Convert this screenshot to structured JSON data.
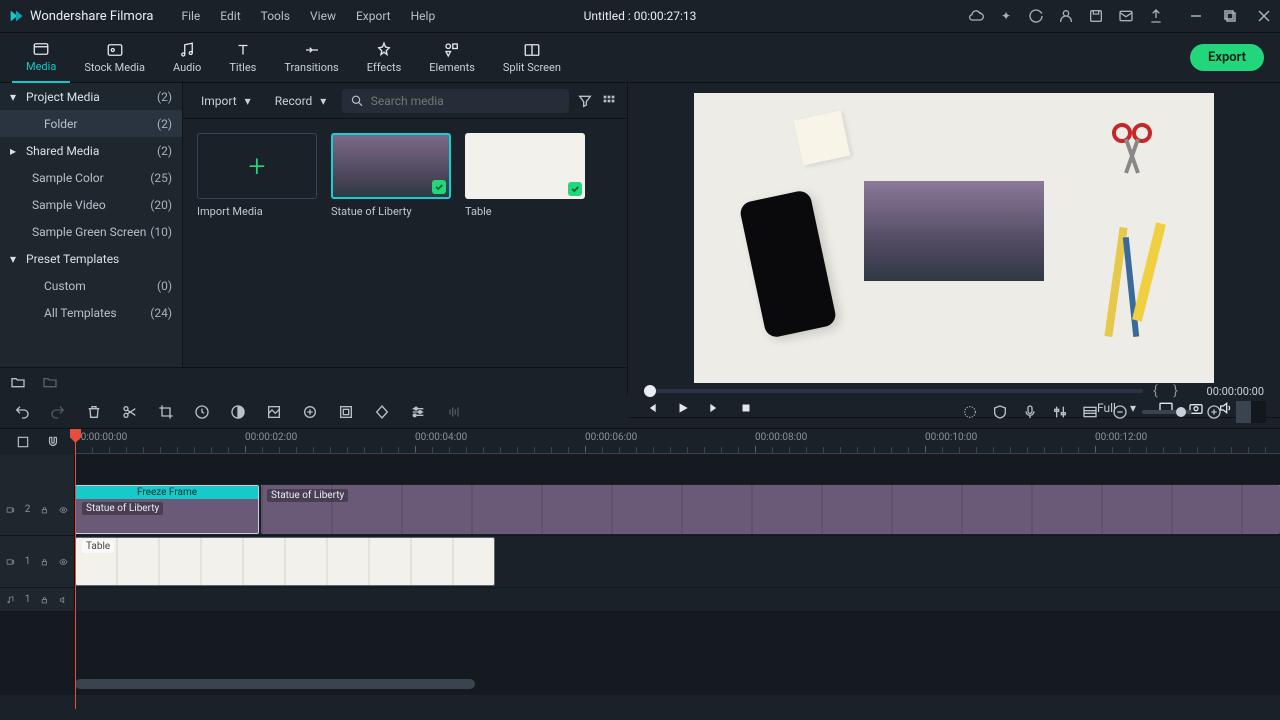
{
  "app": {
    "name": "Wondershare Filmora",
    "title": "Untitled : 00:00:27:13"
  },
  "menu": [
    "File",
    "Edit",
    "Tools",
    "View",
    "Export",
    "Help"
  ],
  "tabs": [
    {
      "label": "Media",
      "active": true
    },
    {
      "label": "Stock Media"
    },
    {
      "label": "Audio"
    },
    {
      "label": "Titles"
    },
    {
      "label": "Transitions"
    },
    {
      "label": "Effects"
    },
    {
      "label": "Elements"
    },
    {
      "label": "Split Screen"
    }
  ],
  "export_btn": "Export",
  "sidebar": {
    "project_media": {
      "label": "Project Media",
      "count": "(2)"
    },
    "folder": {
      "label": "Folder",
      "count": "(2)"
    },
    "shared_media": {
      "label": "Shared Media",
      "count": "(2)"
    },
    "sample_color": {
      "label": "Sample Color",
      "count": "(25)"
    },
    "sample_video": {
      "label": "Sample Video",
      "count": "(20)"
    },
    "sample_green": {
      "label": "Sample Green Screen",
      "count": "(10)"
    },
    "preset_templates": {
      "label": "Preset Templates"
    },
    "custom": {
      "label": "Custom",
      "count": "(0)"
    },
    "all_templates": {
      "label": "All Templates",
      "count": "(24)"
    }
  },
  "media_head": {
    "import": "Import",
    "record": "Record",
    "search_placeholder": "Search media"
  },
  "media_cards": {
    "import": "Import Media",
    "sol": "Statue of Liberty",
    "table": "Table"
  },
  "preview": {
    "timecode": "00:00:00:00",
    "quality": "Full"
  },
  "ruler": [
    "00:00:00:00",
    "00:00:02:00",
    "00:00:04:00",
    "00:00:06:00",
    "00:00:08:00",
    "00:00:10:00",
    "00:00:12:00"
  ],
  "timeline": {
    "freeze_label": "Freeze Frame",
    "clip_sol": "Statue of Liberty",
    "clip_sol2": "Statue of Liberty",
    "clip_table": "Table",
    "tracks": {
      "v2": "2",
      "v1": "1",
      "a1": "1"
    }
  }
}
